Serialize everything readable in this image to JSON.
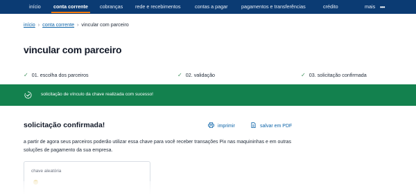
{
  "nav": {
    "items": [
      {
        "label": "início"
      },
      {
        "label": "conta corrente"
      },
      {
        "label": "cobranças"
      },
      {
        "label": "rede e recebimentos"
      },
      {
        "label": "contas a pagar"
      },
      {
        "label": "pagamentos e transferências"
      },
      {
        "label": "crédito"
      }
    ],
    "more_label": "mais",
    "more_icon": "more-dots-icon",
    "active_index": 1,
    "underline_color": "#ff7a00"
  },
  "breadcrumb": {
    "items": [
      "início",
      "conta corrente",
      "vincular com parceiro"
    ]
  },
  "page": {
    "title": "vincular com parceiro"
  },
  "steps": [
    {
      "label": "01. escolha dos parceiros",
      "status": "done"
    },
    {
      "label": "02. validação",
      "status": "done"
    },
    {
      "label": "03. solicitação confirmada",
      "status": "done"
    }
  ],
  "banner": {
    "text": "solicitação de vínculo da chave realizada com sucesso!",
    "color": "#13814e",
    "icon": "success-icon"
  },
  "confirmation": {
    "title": "solicitação confirmada!",
    "print_label": "imprimir",
    "pdf_label": "salvar em PDF",
    "description": "a partir de agora seus parceiros poderão utilizar essa chave para você receber transações Pix nas maquininhas e em outras soluções de pagamento da sua empresa."
  },
  "key_card": {
    "label": "chave aleatória"
  },
  "colors": {
    "brand_navy": "#0b3b73",
    "link_blue": "#0b63a8",
    "success_green": "#13814e",
    "check_green": "#3d8f5a"
  }
}
